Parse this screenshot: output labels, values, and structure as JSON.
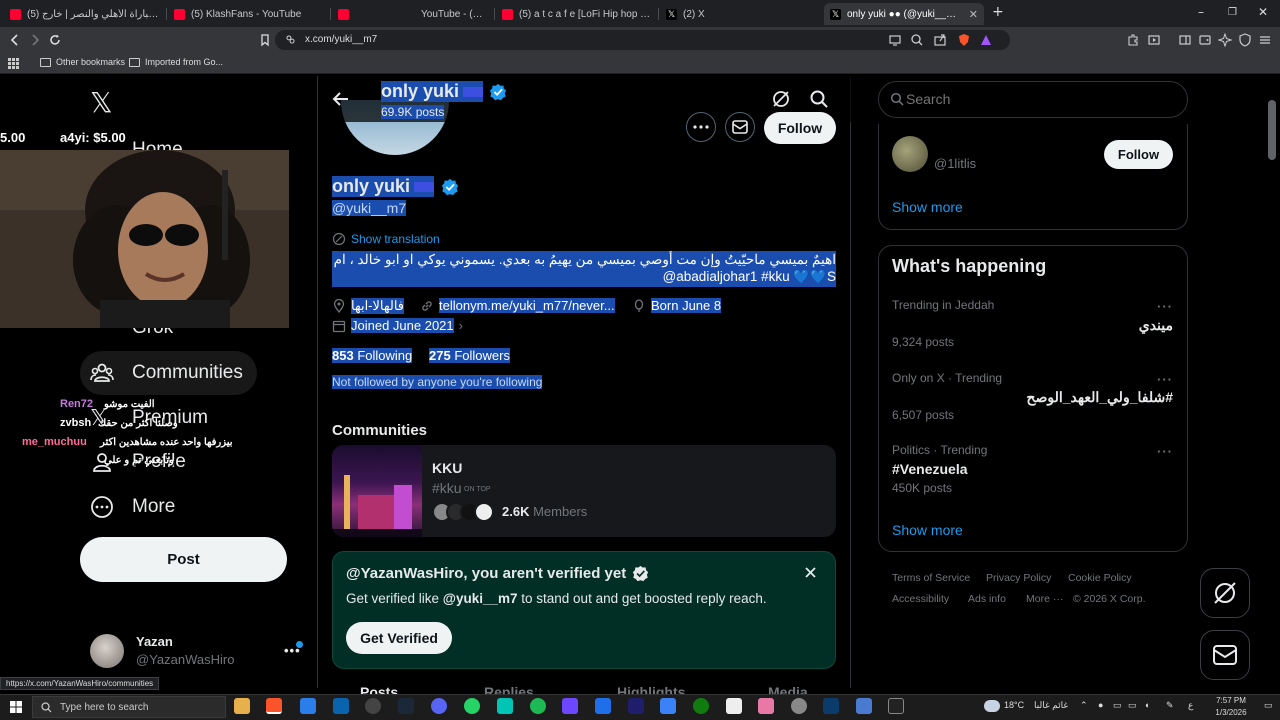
{
  "browser": {
    "tabs": [
      {
        "title": "(5) كواليس مباراة الأهلي والنصر | خارج",
        "fav": "#ff0033"
      },
      {
        "title": "(5) KlashFans - YouTube",
        "fav": "#ff0033"
      },
      {
        "title": "YouTube - سدوكو (5)",
        "fav": "#ff0033"
      },
      {
        "title": "(5) a t c a f e [LoFi Hip hop Jazz",
        "fav": "#ff0033"
      },
      {
        "title": "(2) X",
        "fav": "#000000"
      },
      {
        "title": "only yuki ●● (@yuki__m7) / X",
        "fav": "#000000"
      }
    ],
    "new_tab": "+",
    "url": "x.com/yuki__m7",
    "bookmarks": [
      "Other bookmarks",
      "Imported from Go..."
    ],
    "status_url": "https://x.com/YazanWasHiro/communities"
  },
  "nav": {
    "items": {
      "communities": "Communities",
      "premium": "Premium",
      "profile": "Profile",
      "more": "More",
      "grok": "Grok",
      "home": "Home"
    },
    "post": "Post",
    "account": {
      "name": "Yazan",
      "handle": "@YazanWasHiro",
      "more": "•••"
    }
  },
  "overlay": {
    "donations": [
      {
        "text": "5.00"
      },
      {
        "text": "a4yi: $5.00"
      }
    ],
    "chat": [
      {
        "name": "Ren72",
        "msg": "الفيت موشو",
        "color": "#c678dd"
      },
      {
        "name": "zvbsh",
        "msg": "وصلنا اكثر من حقك",
        "color": "#ffffff"
      },
      {
        "name": "me_muchuu",
        "msg": "بيزرفها واحد عنده مشاهدين اكثر",
        "color": "#ff6b9d"
      },
      {
        "name": "",
        "msg": "وتابعني تم و علي",
        "color": "#ffffff"
      }
    ]
  },
  "profile": {
    "header_name": "only yuki",
    "header_posts": "69.9K posts",
    "name": "only yuki",
    "handle": "@yuki__m7",
    "follow": "Follow",
    "translate": "Show translation",
    "bio_line1": "اهيمٌ بميسي ماحيّيتُ وإن مت أوصي بميسي من يهيمُ به بعدي. يسموني يوكي او ابو خالد ، ام خالد",
    "bio_line2": "@abadialjohar1 #kku 💙💙S",
    "location": "فالهالا-ابها",
    "website": "tellonym.me/yuki_m77/never...",
    "born": "Born June 8",
    "joined": "Joined June 2021",
    "following_count": "853",
    "following_label": "Following",
    "followers_count": "275",
    "followers_label": "Followers",
    "not_followed": "Not followed by anyone you're following"
  },
  "communities": {
    "heading": "Communities",
    "name": "KKU",
    "tag": "#kku",
    "tag_badge": "ON TOP",
    "members_count": "2.6K",
    "members_label": "Members"
  },
  "verify": {
    "title": "@YazanWasHiro, you aren't verified yet",
    "body_pre": "Get verified like ",
    "body_handle": "@yuki__m7",
    "body_post": " to stand out and get boosted reply reach.",
    "cta": "Get Verified"
  },
  "profile_tabs": [
    "Posts",
    "Replies",
    "Highlights",
    "Media"
  ],
  "right": {
    "search_placeholder": "Search",
    "who_to_follow": {
      "handle": "@1litlis",
      "follow": "Follow",
      "show_more": "Show more"
    },
    "happening": {
      "title": "What's happening",
      "trends": [
        {
          "category": "Trending in Jeddah",
          "name": "ميندي",
          "count": "9,324 posts",
          "rtl": true
        },
        {
          "category": "Only on X · Trending",
          "name": "#شلفا_ولي_العهد_الوصح",
          "count": "6,507 posts",
          "rtl": true
        },
        {
          "category": "Politics · Trending",
          "name": "#Venezuela",
          "count": "450K posts",
          "rtl": false
        }
      ],
      "show_more": "Show more"
    },
    "footer": [
      "Terms of Service",
      "Privacy Policy",
      "Cookie Policy",
      "Accessibility",
      "Ads info",
      "More ···",
      "© 2026 X Corp."
    ]
  },
  "taskbar": {
    "search": "Type here to search",
    "weather": "18°C",
    "weather_text": "غائم غالبا",
    "lang": "ع",
    "time": "7:57 PM",
    "date": "1/3/2026"
  }
}
